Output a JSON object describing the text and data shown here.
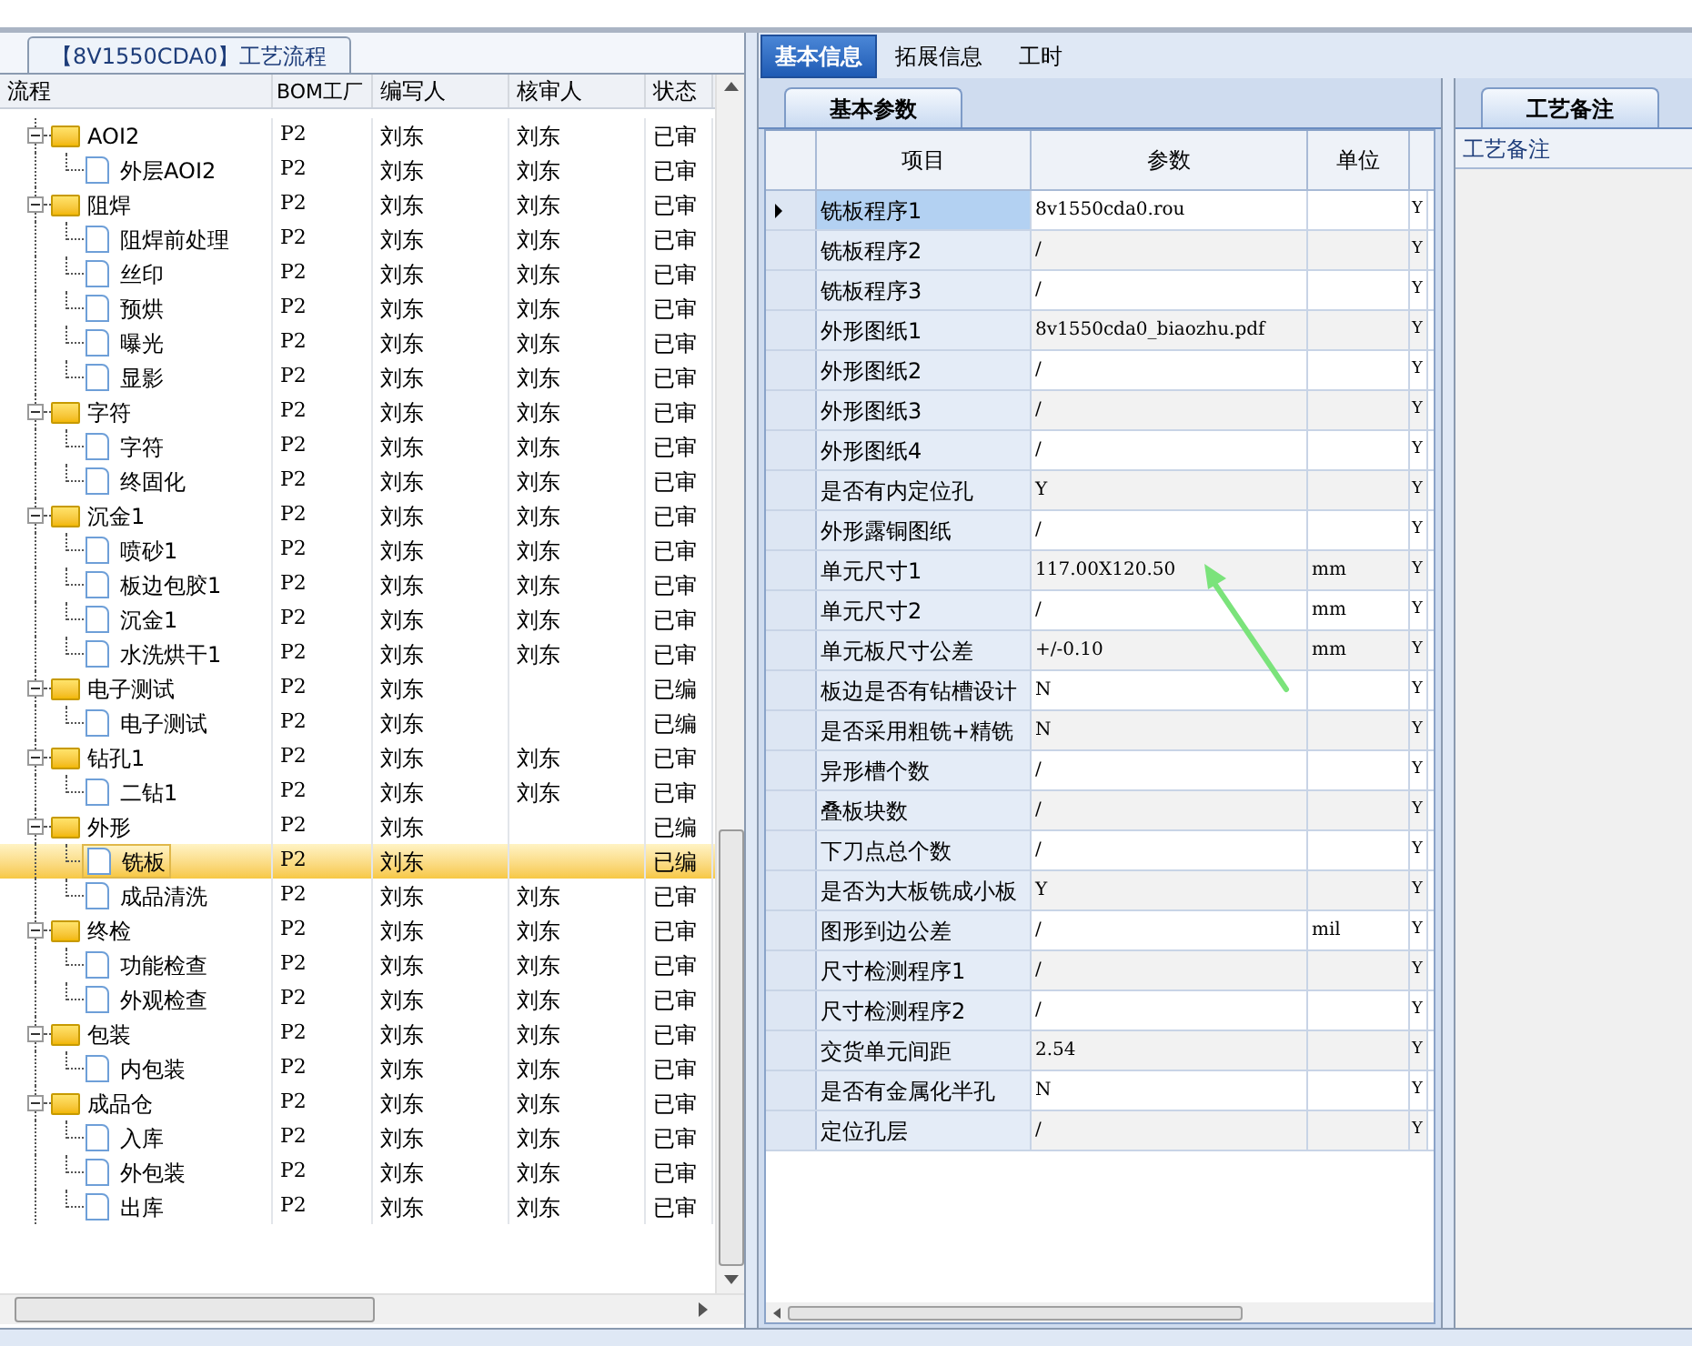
{
  "flow_panel": {
    "title": "【8V1550CDA0】工艺流程",
    "columns": [
      "流程",
      "BOM工厂",
      "编写人",
      "核审人",
      "状态"
    ],
    "rows": [
      {
        "name": "AOI2",
        "factory": "P2",
        "writer": "刘东",
        "reviewer": "刘东",
        "status": "已审",
        "expanded": true,
        "selected": false,
        "children": [
          {
            "name": "外层AOI2",
            "factory": "P2",
            "writer": "刘东",
            "reviewer": "刘东",
            "status": "已审",
            "selected": false
          }
        ]
      },
      {
        "name": "阻焊",
        "factory": "P2",
        "writer": "刘东",
        "reviewer": "刘东",
        "status": "已审",
        "expanded": true,
        "selected": false,
        "children": [
          {
            "name": "阻焊前处理",
            "factory": "P2",
            "writer": "刘东",
            "reviewer": "刘东",
            "status": "已审",
            "selected": false
          },
          {
            "name": "丝印",
            "factory": "P2",
            "writer": "刘东",
            "reviewer": "刘东",
            "status": "已审",
            "selected": false
          },
          {
            "name": "预烘",
            "factory": "P2",
            "writer": "刘东",
            "reviewer": "刘东",
            "status": "已审",
            "selected": false
          },
          {
            "name": "曝光",
            "factory": "P2",
            "writer": "刘东",
            "reviewer": "刘东",
            "status": "已审",
            "selected": false
          },
          {
            "name": "显影",
            "factory": "P2",
            "writer": "刘东",
            "reviewer": "刘东",
            "status": "已审",
            "selected": false
          }
        ]
      },
      {
        "name": "字符",
        "factory": "P2",
        "writer": "刘东",
        "reviewer": "刘东",
        "status": "已审",
        "expanded": true,
        "selected": false,
        "children": [
          {
            "name": "字符",
            "factory": "P2",
            "writer": "刘东",
            "reviewer": "刘东",
            "status": "已审",
            "selected": false
          },
          {
            "name": "终固化",
            "factory": "P2",
            "writer": "刘东",
            "reviewer": "刘东",
            "status": "已审",
            "selected": false
          }
        ]
      },
      {
        "name": "沉金1",
        "factory": "P2",
        "writer": "刘东",
        "reviewer": "刘东",
        "status": "已审",
        "expanded": true,
        "selected": false,
        "children": [
          {
            "name": "喷砂1",
            "factory": "P2",
            "writer": "刘东",
            "reviewer": "刘东",
            "status": "已审",
            "selected": false
          },
          {
            "name": "板边包胶1",
            "factory": "P2",
            "writer": "刘东",
            "reviewer": "刘东",
            "status": "已审",
            "selected": false
          },
          {
            "name": "沉金1",
            "factory": "P2",
            "writer": "刘东",
            "reviewer": "刘东",
            "status": "已审",
            "selected": false
          },
          {
            "name": "水洗烘干1",
            "factory": "P2",
            "writer": "刘东",
            "reviewer": "刘东",
            "status": "已审",
            "selected": false
          }
        ]
      },
      {
        "name": "电子测试",
        "factory": "P2",
        "writer": "刘东",
        "status": "已编",
        "expanded": true,
        "selected": false,
        "children": [
          {
            "name": "电子测试",
            "factory": "P2",
            "writer": "刘东",
            "status": "已编",
            "selected": false
          }
        ]
      },
      {
        "name": "钻孔1",
        "factory": "P2",
        "writer": "刘东",
        "reviewer": "刘东",
        "status": "已审",
        "expanded": true,
        "selected": false,
        "children": [
          {
            "name": "二钻1",
            "factory": "P2",
            "writer": "刘东",
            "reviewer": "刘东",
            "status": "已审",
            "selected": false
          }
        ]
      },
      {
        "name": "外形",
        "factory": "P2",
        "writer": "刘东",
        "status": "已编",
        "expanded": true,
        "selected": false,
        "children": [
          {
            "name": "铣板",
            "factory": "P2",
            "writer": "刘东",
            "status": "已编",
            "selected": true
          },
          {
            "name": "成品清洗",
            "factory": "P2",
            "writer": "刘东",
            "reviewer": "刘东",
            "status": "已审",
            "selected": false
          }
        ]
      },
      {
        "name": "终检",
        "factory": "P2",
        "writer": "刘东",
        "reviewer": "刘东",
        "status": "已审",
        "expanded": true,
        "selected": false,
        "children": [
          {
            "name": "功能检查",
            "factory": "P2",
            "writer": "刘东",
            "reviewer": "刘东",
            "status": "已审",
            "selected": false
          },
          {
            "name": "外观检查",
            "factory": "P2",
            "writer": "刘东",
            "reviewer": "刘东",
            "status": "已审",
            "selected": false
          }
        ]
      },
      {
        "name": "包装",
        "factory": "P2",
        "writer": "刘东",
        "reviewer": "刘东",
        "status": "已审",
        "expanded": true,
        "selected": false,
        "children": [
          {
            "name": "内包装",
            "factory": "P2",
            "writer": "刘东",
            "reviewer": "刘东",
            "status": "已审",
            "selected": false
          }
        ]
      },
      {
        "name": "成品仓",
        "factory": "P2",
        "writer": "刘东",
        "reviewer": "刘东",
        "status": "已审",
        "expanded": true,
        "selected": false,
        "children": [
          {
            "name": "入库",
            "factory": "P2",
            "writer": "刘东",
            "reviewer": "刘东",
            "status": "已审",
            "selected": false
          },
          {
            "name": "外包装",
            "factory": "P2",
            "writer": "刘东",
            "reviewer": "刘东",
            "status": "已审",
            "selected": false
          },
          {
            "name": "出库",
            "factory": "P2",
            "writer": "刘东",
            "reviewer": "刘东",
            "status": "已审",
            "selected": false
          }
        ]
      }
    ]
  },
  "tabs": [
    {
      "label": "基本信息",
      "selected": true
    },
    {
      "label": "拓展信息",
      "selected": false
    },
    {
      "label": "工时",
      "selected": false
    }
  ],
  "sub_tab": {
    "label": "基本参数"
  },
  "grid": {
    "columns": [
      "项目",
      "参数",
      "单位"
    ],
    "rows": [
      {
        "item": "铣板程序1",
        "value": "8v1550cda0.rou",
        "column_4": "Y",
        "current": true
      },
      {
        "item": "铣板程序2",
        "value": "/",
        "column_4": "Y",
        "current": false
      },
      {
        "item": "铣板程序3",
        "value": "/",
        "column_4": "Y",
        "current": false
      },
      {
        "item": "外形图纸1",
        "value": "8v1550cda0_biaozhu.pdf",
        "column_4": "Y",
        "current": false
      },
      {
        "item": "外形图纸2",
        "value": "/",
        "column_4": "Y",
        "current": false
      },
      {
        "item": "外形图纸3",
        "value": "/",
        "column_4": "Y",
        "current": false
      },
      {
        "item": "外形图纸4",
        "value": "/",
        "column_4": "Y",
        "current": false
      },
      {
        "item": "是否有内定位孔",
        "value": "Y",
        "column_4": "Y",
        "current": false
      },
      {
        "item": "外形露铜图纸",
        "value": "/",
        "column_4": "Y",
        "current": false
      },
      {
        "item": "单元尺寸1",
        "value": "117.00X120.50",
        "unit": "mm",
        "column_4": "Y",
        "current": false
      },
      {
        "item": "单元尺寸2",
        "value": "/",
        "unit": "mm",
        "column_4": "Y",
        "current": false
      },
      {
        "item": "单元板尺寸公差",
        "value": "+/-0.10",
        "unit": "mm",
        "column_4": "Y",
        "current": false
      },
      {
        "item": "板边是否有钻槽设计",
        "value": "N",
        "column_4": "Y",
        "current": false
      },
      {
        "item": "是否采用粗铣+精铣",
        "value": "N",
        "column_4": "Y",
        "current": false
      },
      {
        "item": "异形槽个数",
        "value": "/",
        "column_4": "Y",
        "current": false
      },
      {
        "item": "叠板块数",
        "value": "/",
        "column_4": "Y",
        "current": false
      },
      {
        "item": "下刀点总个数",
        "value": "/",
        "column_4": "Y",
        "current": false
      },
      {
        "item": "是否为大板铣成小板",
        "value": "Y",
        "column_4": "Y",
        "current": false
      },
      {
        "item": "图形到边公差",
        "value": "/",
        "unit": "mil",
        "column_4": "Y",
        "current": false
      },
      {
        "item": "尺寸检测程序1",
        "value": "/",
        "column_4": "Y",
        "current": false
      },
      {
        "item": "尺寸检测程序2",
        "value": "/",
        "column_4": "Y",
        "current": false
      },
      {
        "item": "交货单元间距",
        "value": "2.54",
        "column_4": "Y",
        "current": false
      },
      {
        "item": "是否有金属化半孔",
        "value": "N",
        "column_4": "Y",
        "current": false
      },
      {
        "item": "定位孔层",
        "value": "/",
        "column_4": "Y",
        "current": false
      }
    ]
  },
  "notes_panel": {
    "tab": "工艺备注",
    "header": "工艺备注"
  }
}
